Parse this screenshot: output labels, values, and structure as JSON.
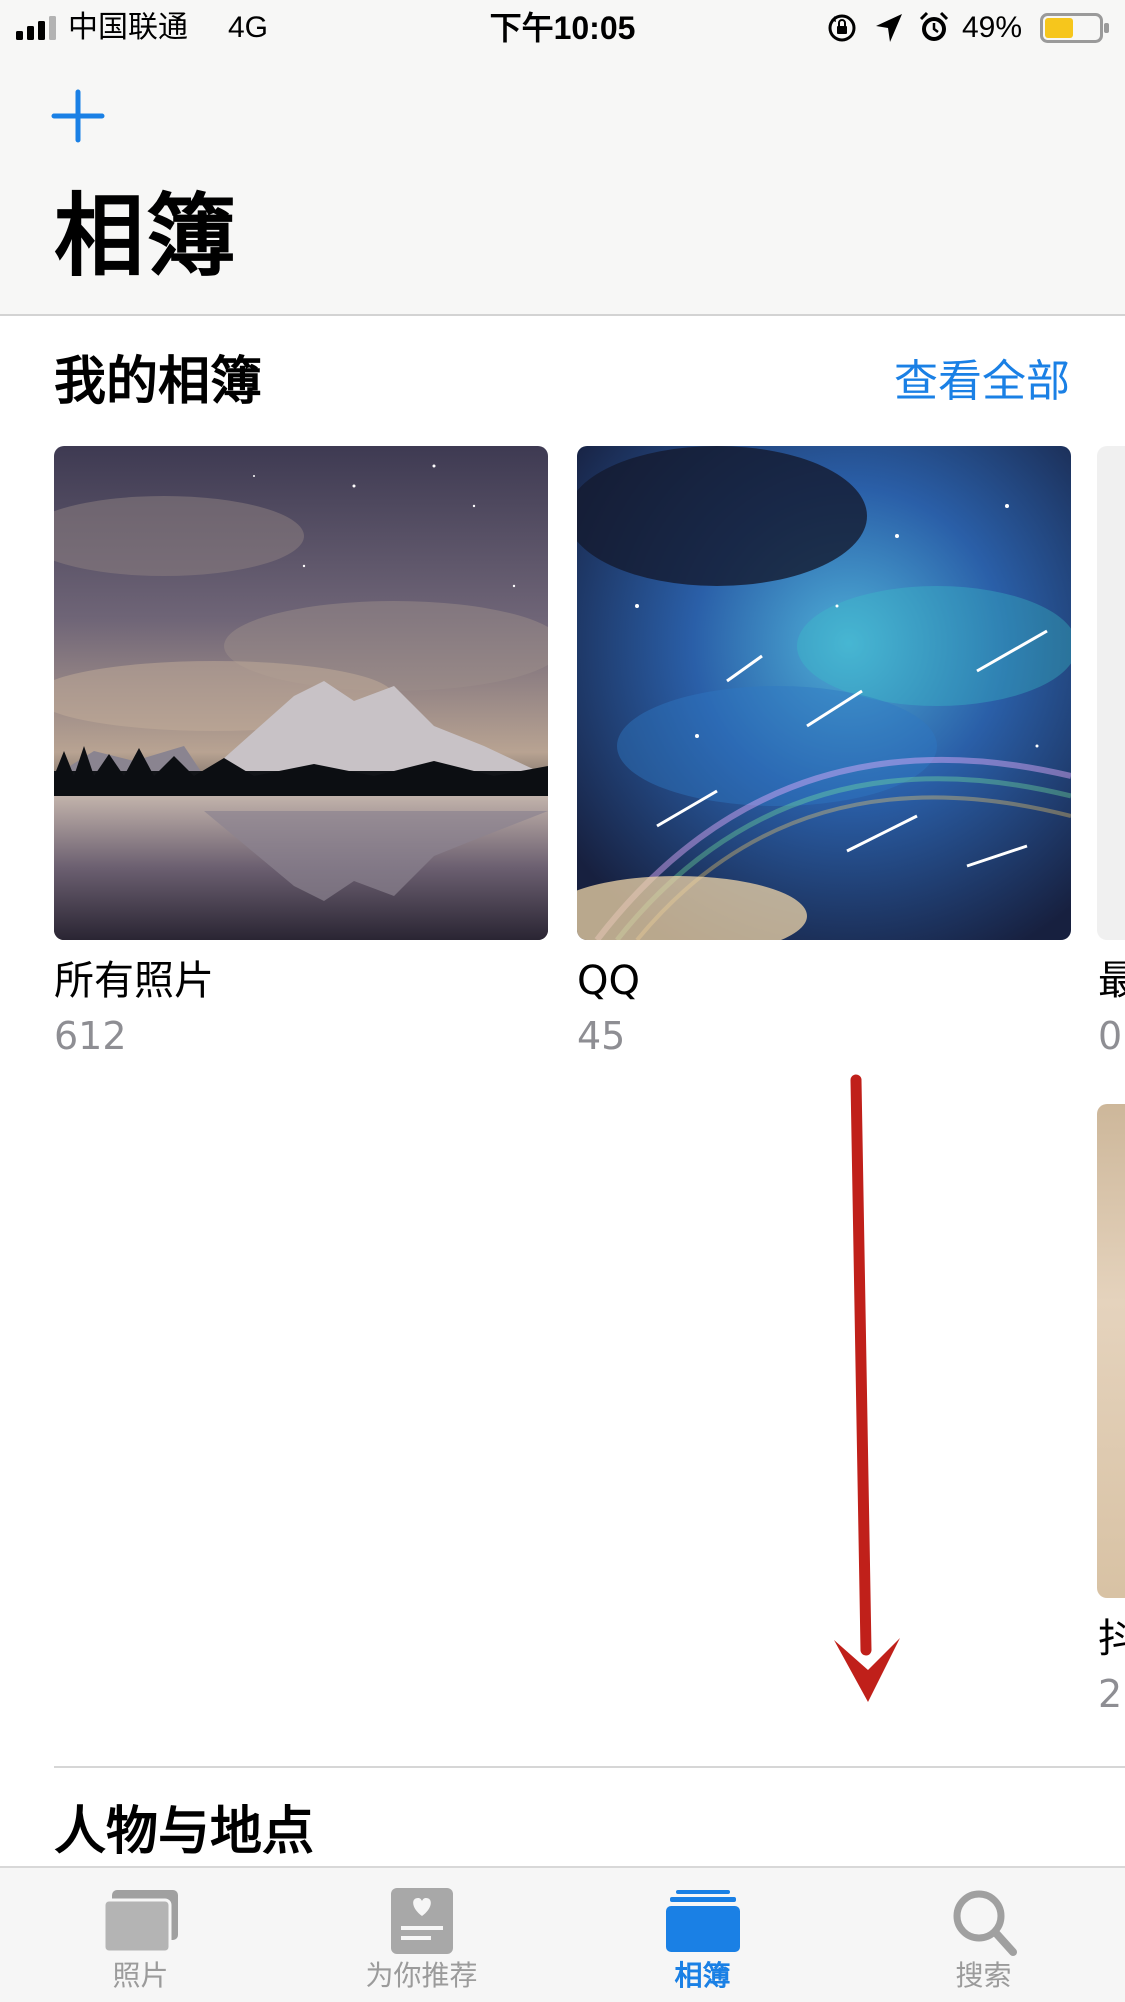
{
  "status_bar": {
    "carrier": "中国联通",
    "network": "4G",
    "time": "下午10:05",
    "battery_percent": "49%",
    "icons": [
      "signal-icon",
      "orientation-lock-icon",
      "location-icon",
      "alarm-icon",
      "battery-icon"
    ]
  },
  "header": {
    "add_icon": "plus-icon",
    "title": "相簿"
  },
  "my_albums": {
    "title": "我的相簿",
    "see_all": "查看全部",
    "albums": [
      {
        "name": "所有照片",
        "count": "612"
      },
      {
        "name": "QQ",
        "count": "45"
      },
      {
        "name": "最",
        "count": "0"
      },
      {
        "name": "抖",
        "count": "2"
      }
    ]
  },
  "people_places": {
    "title": "人物与地点"
  },
  "tab_bar": {
    "tabs": [
      {
        "label": "照片",
        "icon": "photos-icon",
        "active": false
      },
      {
        "label": "为你推荐",
        "icon": "for-you-icon",
        "active": false
      },
      {
        "label": "相簿",
        "icon": "albums-icon",
        "active": true
      },
      {
        "label": "搜索",
        "icon": "search-icon",
        "active": false
      }
    ],
    "active_color": "#1a80e5",
    "inactive_color": "#9b9b9b"
  },
  "accent_color": "#1a80e5",
  "annotation_arrow_color": "#c0201a"
}
